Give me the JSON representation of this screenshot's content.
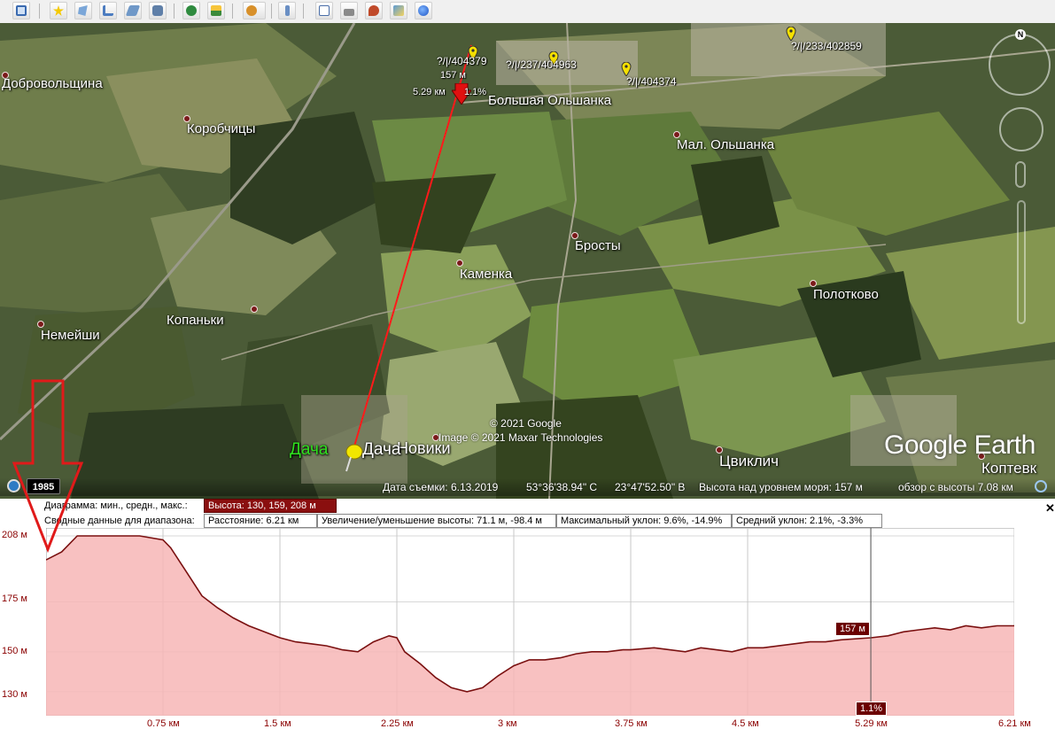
{
  "toolbar": {
    "buttons": [
      "sidebar-toggle",
      "add-placemark",
      "add-polygon",
      "add-path",
      "add-image-overlay",
      "record-tour",
      "historical-imagery",
      "sunlight",
      "switch-planet",
      "ruler",
      "email",
      "print",
      "view-in-maps",
      "save-image",
      "earth-gallery"
    ]
  },
  "map": {
    "places": [
      {
        "name": "Добровольщина"
      },
      {
        "name": "Коробчицы"
      },
      {
        "name": "Большая Ольшанка"
      },
      {
        "name": "Мал. Ольшанка"
      },
      {
        "name": "Бросты"
      },
      {
        "name": "Каменка"
      },
      {
        "name": "Полотково"
      },
      {
        "name": "Копаньки"
      },
      {
        "name": "Немейши"
      },
      {
        "name": "Новики"
      },
      {
        "name": "Цвиклич"
      },
      {
        "name": "Коптевк"
      }
    ],
    "pins": [
      {
        "label": "?/|/404379"
      },
      {
        "label": "?/|/237/404963"
      },
      {
        "label": "?/|/404374"
      },
      {
        "label": "?/|/233/402859"
      }
    ],
    "dacha_label_green": "Дача",
    "dacha_label_white": "Дача",
    "cursor_elevation": "157 м",
    "cursor_distance": "5.29 км",
    "cursor_slope": "1.1%",
    "copyright_1": "© 2021 Google",
    "copyright_2": "Image © 2021 Maxar Technologies",
    "logo": "Google Earth",
    "north_label": "N"
  },
  "status": {
    "year": "1985",
    "date": "Дата съемки: 6.13.2019",
    "lat": "53°36'38.94\" С",
    "lon": "23°47'52.50\" В",
    "altitude": "Высота над уровнем моря:   157 м",
    "eye": "обзор с высоты   7.08 км"
  },
  "profile": {
    "row1_label": "Диаграмма: мин., средн., макс.:",
    "row1_value": "Высота: 130, 159, 208 м",
    "row2_label": "Сводные данные для диапазона:",
    "row2_distance": "Расстояние: 6.21 км",
    "row2_gain": "Увеличение/уменьшение высоты: 71.1 м, -98.4 м",
    "row2_max_slope": "Максимальный уклон: 9.6%, -14.9%",
    "row2_avg_slope": "Средний уклон: 2.1%, -3.3%",
    "close": "✕",
    "cursor_value": "157 м",
    "cursor_slope": "1.1%",
    "cursor_x_label": "5.29 км"
  },
  "chart_data": {
    "type": "area",
    "x_unit": "км",
    "y_unit": "м",
    "xlim": [
      0,
      6.21
    ],
    "yticks": [
      130,
      150,
      175,
      208
    ],
    "ytick_labels": [
      "130 м",
      "150 м",
      "175 м",
      "208 м"
    ],
    "xticks": [
      0.75,
      1.5,
      2.25,
      3,
      3.75,
      4.5,
      5.29,
      6.21
    ],
    "xtick_labels": [
      "0.75 км",
      "1.5 км",
      "2.25 км",
      "3 км",
      "3.75 км",
      "4.5 км",
      "5.29 км",
      "6.21 км"
    ],
    "x": [
      0,
      0.1,
      0.2,
      0.3,
      0.45,
      0.6,
      0.75,
      0.8,
      0.9,
      1.0,
      1.1,
      1.2,
      1.3,
      1.4,
      1.5,
      1.6,
      1.7,
      1.8,
      1.9,
      2.0,
      2.1,
      2.2,
      2.25,
      2.3,
      2.4,
      2.5,
      2.6,
      2.7,
      2.8,
      2.9,
      3.0,
      3.1,
      3.2,
      3.3,
      3.4,
      3.5,
      3.6,
      3.7,
      3.75,
      3.9,
      4.0,
      4.1,
      4.2,
      4.3,
      4.4,
      4.5,
      4.6,
      4.7,
      4.8,
      4.9,
      5.0,
      5.1,
      5.29,
      5.4,
      5.5,
      5.6,
      5.7,
      5.8,
      5.9,
      6.0,
      6.1,
      6.21
    ],
    "y": [
      196,
      200,
      208,
      208,
      208,
      208,
      206,
      202,
      190,
      178,
      172,
      167,
      163,
      160,
      157,
      155,
      154,
      153,
      151,
      150,
      155,
      158,
      157,
      150,
      144,
      137,
      132,
      130,
      132,
      138,
      143,
      146,
      146,
      147,
      149,
      150,
      150,
      151,
      151,
      152,
      151,
      150,
      152,
      151,
      150,
      152,
      152,
      153,
      154,
      155,
      155,
      156,
      157,
      158,
      160,
      161,
      162,
      161,
      163,
      162,
      163,
      163
    ]
  }
}
